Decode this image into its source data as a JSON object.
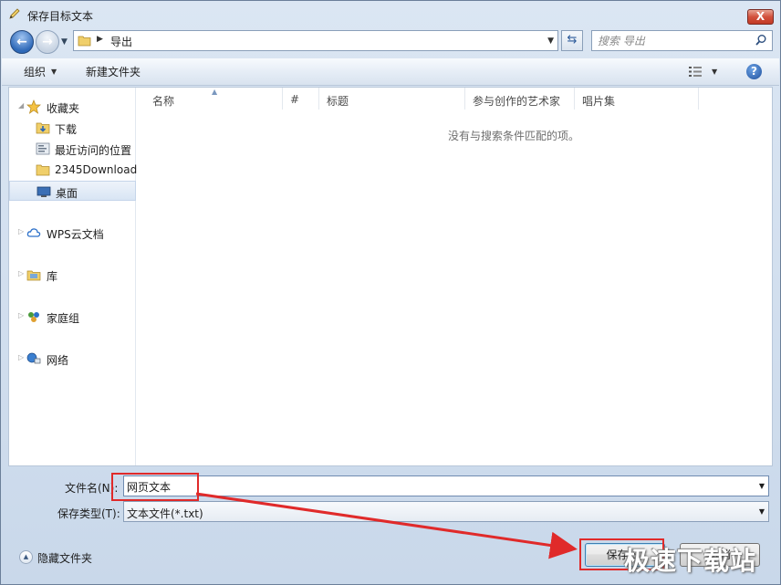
{
  "window": {
    "title": "保存目标文本",
    "close_label": "X"
  },
  "address_bar": {
    "path": "导出"
  },
  "search": {
    "placeholder": "搜索 导出"
  },
  "toolbar": {
    "organize": "组织",
    "new_folder": "新建文件夹",
    "help": "?"
  },
  "nav": {
    "favorites": "收藏夹",
    "downloads": "下载",
    "recent": "最近访问的位置",
    "folder_2345": "2345Download",
    "desktop": "桌面",
    "wps_cloud": "WPS云文档",
    "libraries": "库",
    "homegroup": "家庭组",
    "network": "网络"
  },
  "columns": {
    "name": "名称",
    "number": "#",
    "title": "标题",
    "artist": "参与创作的艺术家",
    "album": "唱片集"
  },
  "empty_message": "没有与搜索条件匹配的项。",
  "form": {
    "filename_label": "文件名(N):",
    "filename_value": "网页文本",
    "filetype_label": "保存类型(T):",
    "filetype_value": "文本文件(*.txt)"
  },
  "footer": {
    "hide_folders": "隐藏文件夹",
    "save": "保存(S)",
    "cancel": "取消"
  },
  "watermark": "极速下载站",
  "colors": {
    "annotation_red": "#e02a2a",
    "accent_blue": "#2e69b8"
  }
}
